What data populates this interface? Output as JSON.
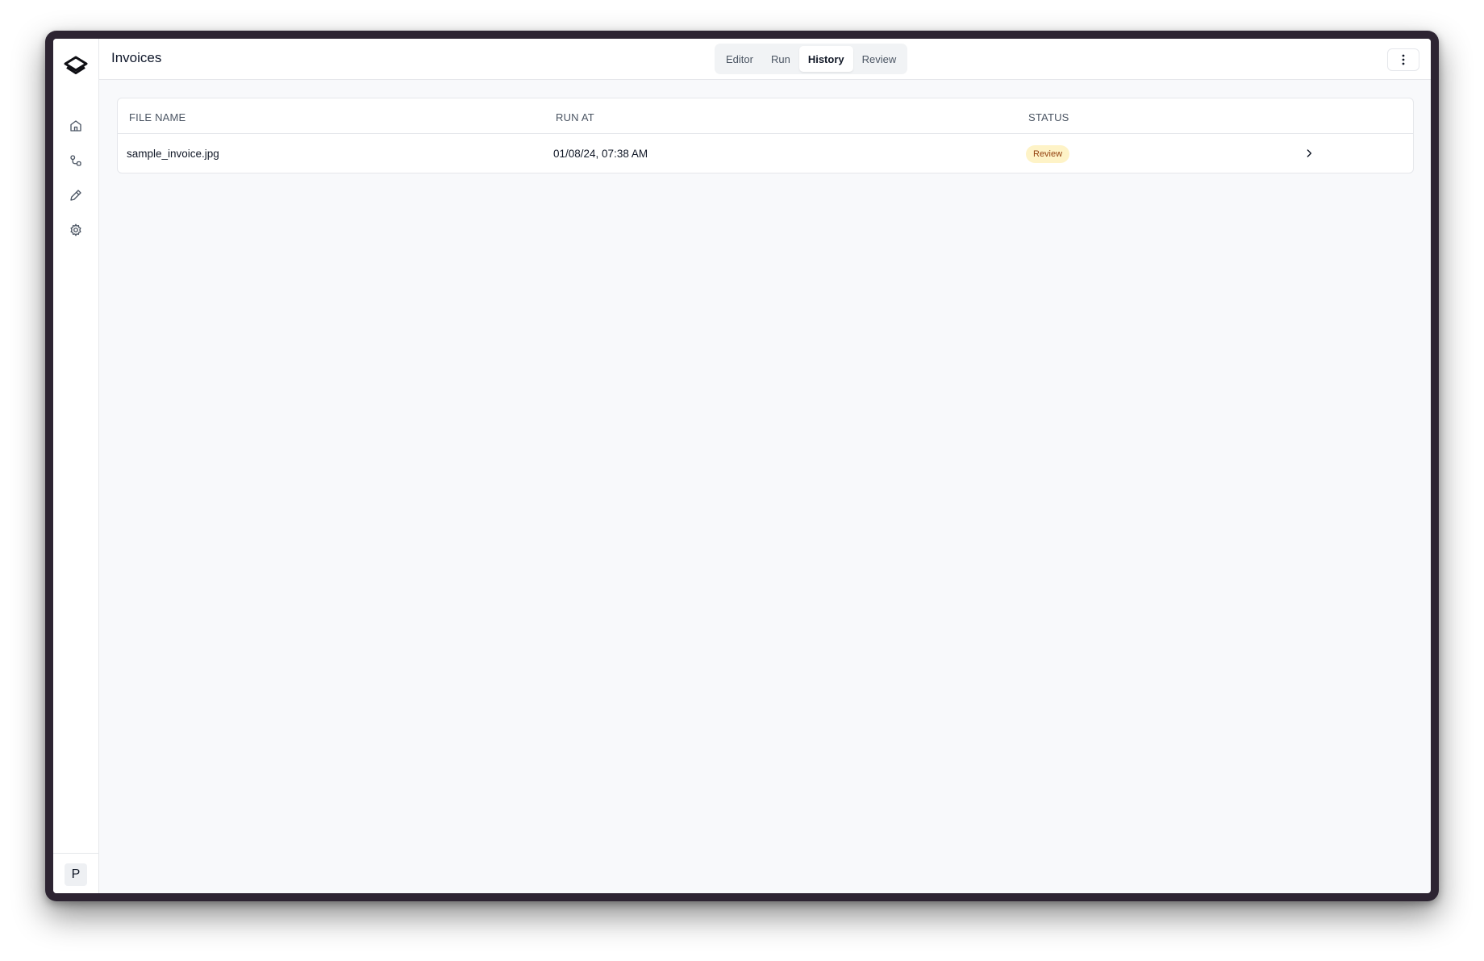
{
  "app": {
    "page_title": "Invoices"
  },
  "sidebar": {
    "items": [
      {
        "icon": "home-icon",
        "label": "Home"
      },
      {
        "icon": "workflow-icon",
        "label": "Workflows"
      },
      {
        "icon": "pen-icon",
        "label": "Editor"
      },
      {
        "icon": "gear-icon",
        "label": "Settings"
      }
    ],
    "avatar_initial": "P"
  },
  "header": {
    "tabs": [
      {
        "label": "Editor",
        "active": false
      },
      {
        "label": "Run",
        "active": false
      },
      {
        "label": "History",
        "active": true
      },
      {
        "label": "Review",
        "active": false
      }
    ],
    "more_icon": "vertical-dots-icon"
  },
  "table": {
    "columns": [
      "FILE NAME",
      "RUN AT",
      "STATUS"
    ],
    "rows": [
      {
        "file_name": "sample_invoice.jpg",
        "run_at": "01/08/24, 07:38 AM",
        "status": "Review"
      }
    ]
  },
  "colors": {
    "status_review_bg": "#fef3c7",
    "status_review_text": "#92400e",
    "device_frame": "#2d2432"
  }
}
